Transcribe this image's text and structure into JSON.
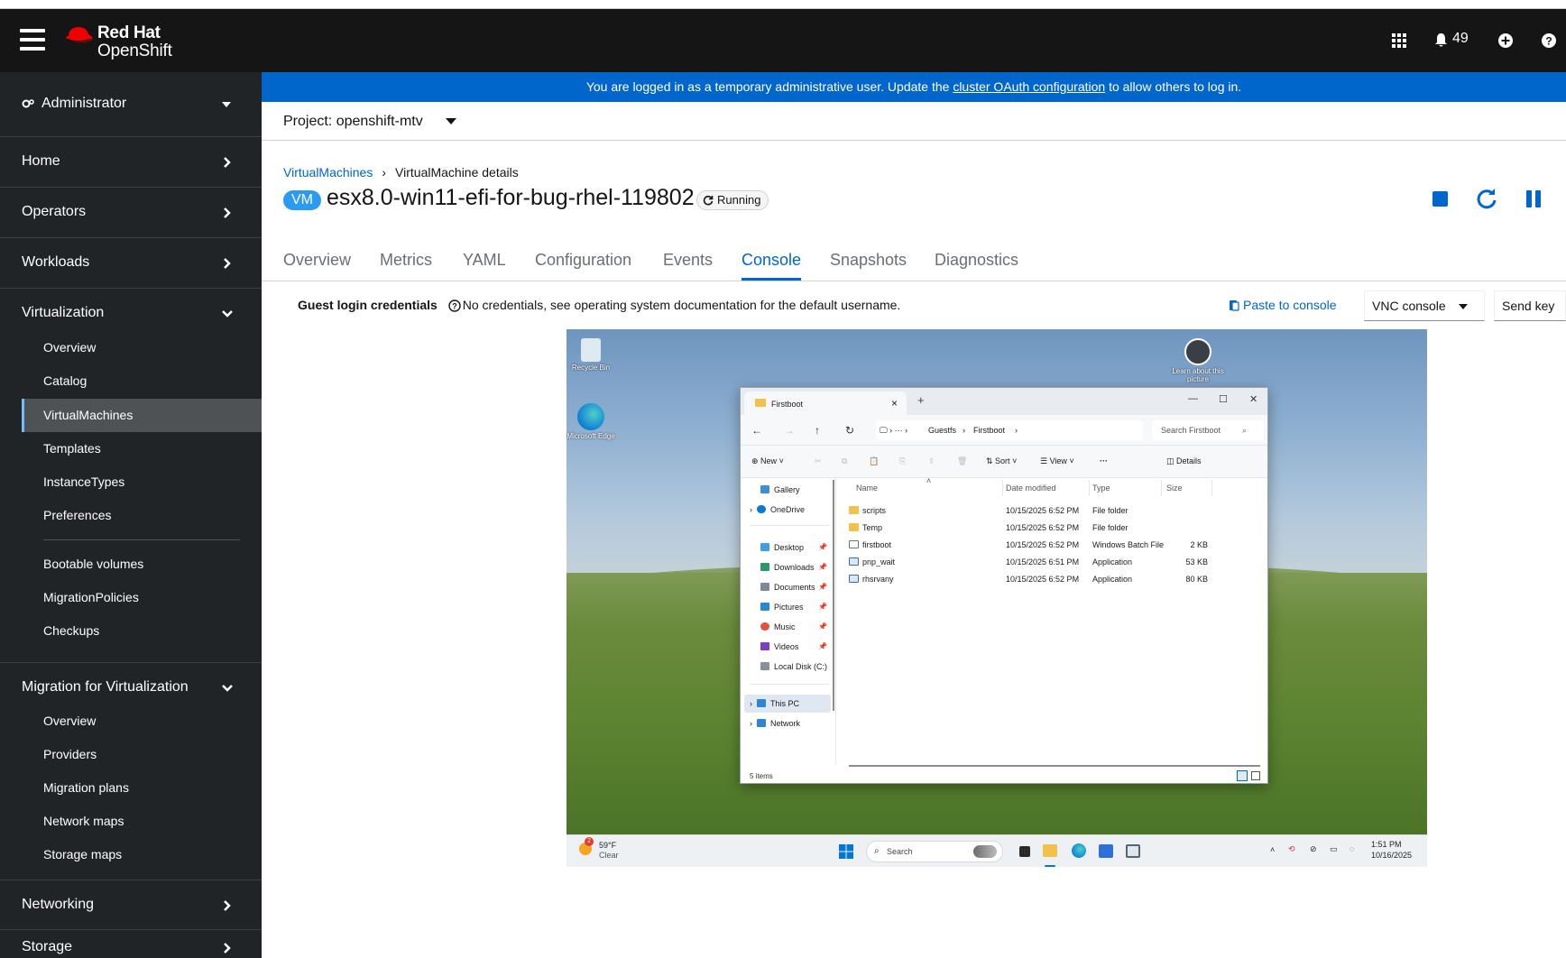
{
  "masthead": {
    "brand_line1": "Red Hat",
    "brand_line2": "OpenShift",
    "notification_count": "49",
    "icons": [
      "menu-icon",
      "app-launcher-icon",
      "bell-icon",
      "plus-circle-icon",
      "help-icon"
    ]
  },
  "sidebar": {
    "perspective": "Administrator",
    "sections": [
      {
        "label": "Home"
      },
      {
        "label": "Operators"
      },
      {
        "label": "Workloads"
      },
      {
        "label": "Virtualization"
      },
      {
        "label": "Migration for Virtualization"
      },
      {
        "label": "Networking"
      },
      {
        "label": "Storage"
      }
    ],
    "virtualization_items": [
      "Overview",
      "Catalog",
      "VirtualMachines",
      "Templates",
      "InstanceTypes",
      "Preferences",
      "Bootable volumes",
      "MigrationPolicies",
      "Checkups"
    ],
    "migration_items": [
      "Overview",
      "Providers",
      "Migration plans",
      "Network maps",
      "Storage maps"
    ],
    "active_item": "VirtualMachines"
  },
  "banner": {
    "prefix": "You are logged in as a temporary administrative user. Update the ",
    "link": "cluster OAuth configuration",
    "suffix": " to allow others to log in."
  },
  "project": {
    "label": "Project: openshift-mtv"
  },
  "breadcrumb": {
    "parent": "VirtualMachines",
    "current": "VirtualMachine details"
  },
  "vm": {
    "badge": "VM",
    "name": "esx8.0-win11-efi-for-bug-rhel-119802",
    "status": "Running"
  },
  "tabs": [
    "Overview",
    "Metrics",
    "YAML",
    "Configuration",
    "Events",
    "Console",
    "Snapshots",
    "Diagnostics"
  ],
  "active_tab": "Console",
  "console": {
    "credentials_label": "Guest login credentials",
    "credentials_text": "No credentials, see operating system documentation for the default username.",
    "paste_label": "Paste to console",
    "console_type": "VNC console",
    "send_key_label": "Send key"
  },
  "guest": {
    "desktop_icons": [
      "Recycle Bin",
      "Microsoft Edge",
      "Learn about this picture"
    ],
    "explorer": {
      "tab_title": "Firstboot",
      "path": [
        "Guestfs",
        "Firstboot"
      ],
      "search_placeholder": "Search Firstboot",
      "commands": {
        "new": "New",
        "sort": "Sort",
        "view": "View",
        "more": "···",
        "details": "Details"
      },
      "sidebar": [
        "Gallery",
        "OneDrive",
        "Desktop",
        "Downloads",
        "Documents",
        "Pictures",
        "Music",
        "Videos",
        "Local Disk (C:)",
        "This PC",
        "Network"
      ],
      "columns": [
        "Name",
        "Date modified",
        "Type",
        "Size"
      ],
      "rows": [
        {
          "name": "scripts",
          "date": "10/15/2025 6:52 PM",
          "type": "File folder",
          "size": ""
        },
        {
          "name": "Temp",
          "date": "10/15/2025 6:52 PM",
          "type": "File folder",
          "size": ""
        },
        {
          "name": "firstboot",
          "date": "10/15/2025 6:52 PM",
          "type": "Windows Batch File",
          "size": "2 KB"
        },
        {
          "name": "pnp_wait",
          "date": "10/15/2025 6:51 PM",
          "type": "Application",
          "size": "53 KB"
        },
        {
          "name": "rhsrvany",
          "date": "10/15/2025 6:52 PM",
          "type": "Application",
          "size": "80 KB"
        }
      ],
      "status": "5 items"
    },
    "taskbar": {
      "weather_temp": "59°F",
      "weather_desc": "Clear",
      "weather_badge": "2",
      "search": "Search",
      "time": "1:51 PM",
      "date": "10/16/2025"
    }
  },
  "colors": {
    "masthead": "#151515",
    "sidebar": "#212427",
    "banner": "#0066cc",
    "link": "#0066cc",
    "vm_badge": "#2b9af3",
    "red_hat": "#ee0000"
  }
}
